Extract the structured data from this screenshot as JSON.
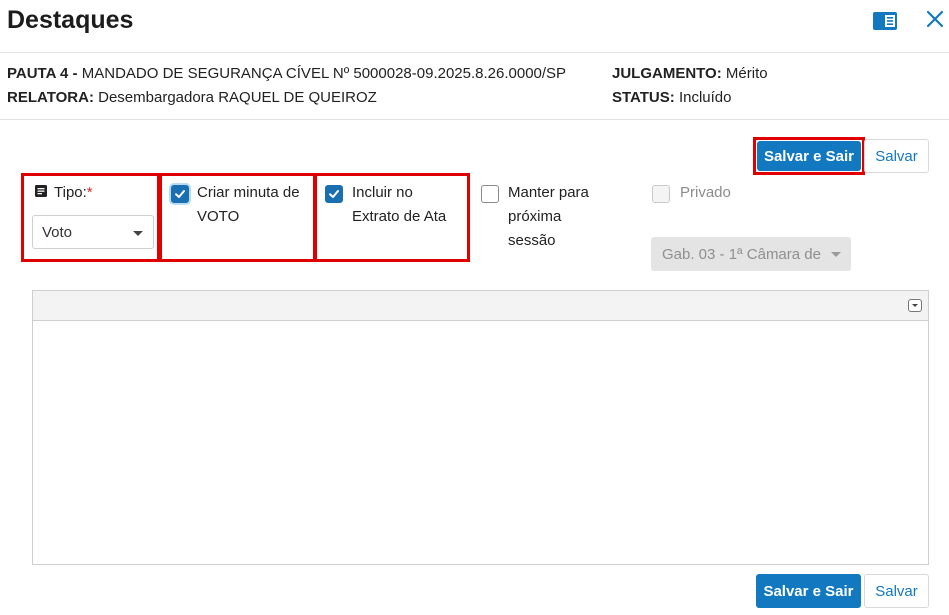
{
  "header": {
    "title": "Destaques",
    "icons": [
      "panel-icon",
      "close-icon"
    ]
  },
  "info": {
    "pauta_label": "PAUTA 4 -",
    "pauta_value": "MANDADO DE SEGURANÇA CÍVEL Nº 5000028-09.2025.8.26.0000/SP",
    "relatora_label": "RELATORA:",
    "relatora_value": "Desembargadora RAQUEL DE QUEIROZ",
    "julgamento_label": "JULGAMENTO:",
    "julgamento_value": "Mérito",
    "status_label": "STATUS:",
    "status_value": "Incluído"
  },
  "toolbar_top": {
    "save_exit_label": "Salvar e Sair",
    "save_label": "Salvar"
  },
  "form": {
    "tipo": {
      "label": "Tipo:",
      "required_mark": "*",
      "selected": "Voto",
      "icon": "note-icon"
    },
    "criar_minuta": {
      "label_line1": "Criar minuta de",
      "label_line2": "VOTO",
      "checked": true
    },
    "incluir_extrato": {
      "label_line1": "Incluir no",
      "label_line2": "Extrato de Ata",
      "checked": true
    },
    "manter_proxima": {
      "label_line1": "Manter para",
      "label_line2": "próxima",
      "label_line3": "sessão",
      "checked": false
    },
    "privado": {
      "label": "Privado",
      "checked": false,
      "disabled": true
    },
    "gabinete": {
      "selected": "Gab. 03 - 1ª Câmara de",
      "disabled": true
    }
  },
  "editor": {
    "content": ""
  },
  "toolbar_bottom": {
    "save_exit_label": "Salvar e Sair",
    "save_label": "Salvar"
  },
  "colors": {
    "primary": "#1278c0",
    "highlight": "#e00000",
    "required": "#d32f2f"
  }
}
